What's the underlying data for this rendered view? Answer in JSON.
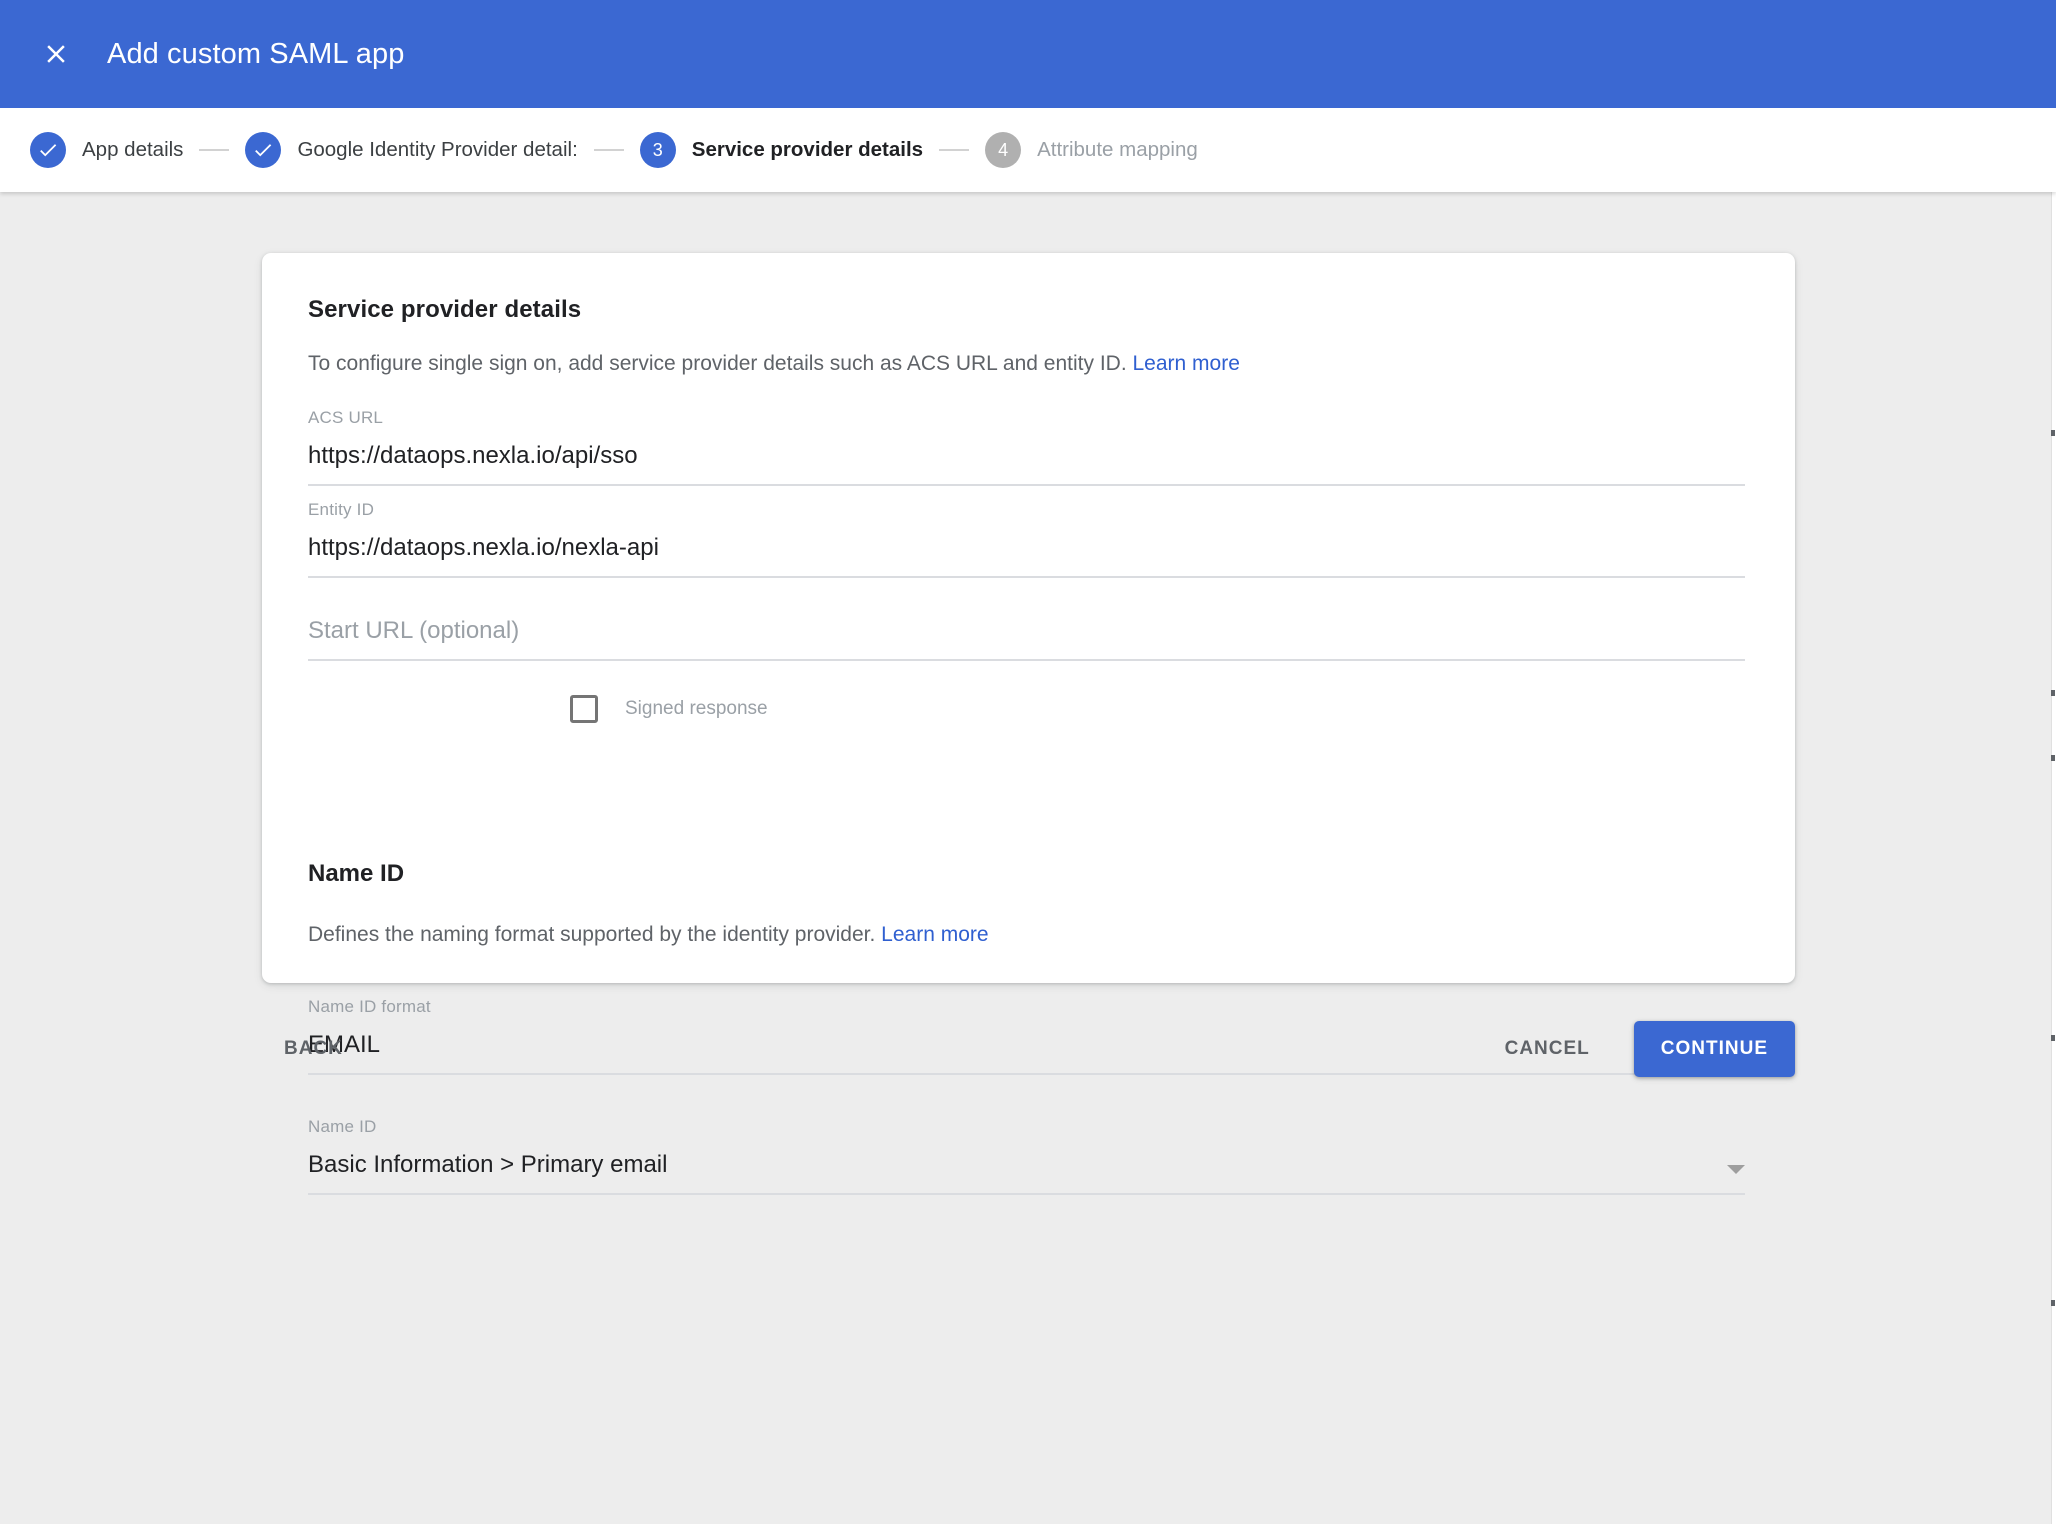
{
  "header": {
    "title": "Add custom SAML app",
    "close_icon": "close-icon",
    "background_color": "#3b68d2"
  },
  "stepper": {
    "steps": [
      {
        "number": "1",
        "label": "App details",
        "state": "done",
        "marker": "check-icon"
      },
      {
        "number": "2",
        "label": "Google Identity Provider detail:",
        "state": "done",
        "marker": "check-icon"
      },
      {
        "number": "3",
        "label": "Service provider details",
        "state": "current",
        "marker": "3"
      },
      {
        "number": "4",
        "label": "Attribute mapping",
        "state": "todo",
        "marker": "4"
      }
    ]
  },
  "card": {
    "title": "Service provider details",
    "description_text": "To configure single sign on, add service provider details such as ACS URL and entity ID.",
    "description_link": "Learn more",
    "fields": {
      "acs_url": {
        "label": "ACS URL",
        "value": "https://dataops.nexla.io/api/sso"
      },
      "entity_id": {
        "label": "Entity ID",
        "value": "https://dataops.nexla.io/nexla-api"
      },
      "start_url": {
        "label": "",
        "placeholder": "Start URL (optional)",
        "value": ""
      },
      "signed_response": {
        "label": "Signed response",
        "checked": false
      }
    },
    "name_id_section": {
      "title": "Name ID",
      "description_text": "Defines the naming format supported by the identity provider.",
      "description_link": "Learn more",
      "name_id_format": {
        "label": "Name ID format",
        "value": "EMAIL"
      },
      "name_id": {
        "label": "Name ID",
        "value": "Basic Information > Primary email"
      }
    }
  },
  "actions": {
    "back_label": "BACK",
    "cancel_label": "CANCEL",
    "continue_label": "CONTINUE",
    "continue_color": "#3b68d2"
  }
}
